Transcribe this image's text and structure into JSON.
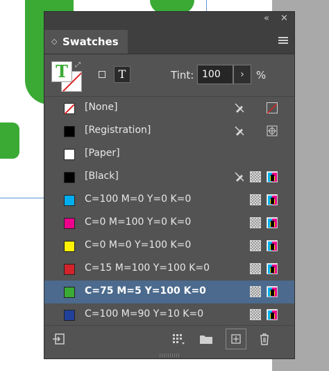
{
  "panel": {
    "title": "Swatches",
    "collapse_label": "«",
    "close_label": "✕",
    "tint_label": "Tint:",
    "tint_value": "100",
    "tint_unit": "%",
    "stepper_label": "›",
    "text_target_label": "T",
    "fill_letter": "T"
  },
  "swatches": [
    {
      "label": "[None]",
      "color": "none",
      "locked": true,
      "right_icon": "none-icon"
    },
    {
      "label": "[Registration]",
      "color": "#000000",
      "locked": true,
      "right_icon": "registration-icon"
    },
    {
      "label": "[Paper]",
      "color": "#ffffff",
      "locked": false,
      "right_icon": ""
    },
    {
      "label": "[Black]",
      "color": "#000000",
      "locked": true,
      "right_icon": "cmyk"
    },
    {
      "label": "C=100 M=0 Y=0 K=0",
      "color": "#00aeef",
      "locked": false,
      "right_icon": "cmyk"
    },
    {
      "label": "C=0 M=100 Y=0 K=0",
      "color": "#ec008c",
      "locked": false,
      "right_icon": "cmyk"
    },
    {
      "label": "C=0 M=0 Y=100 K=0",
      "color": "#fff200",
      "locked": false,
      "right_icon": "cmyk"
    },
    {
      "label": "C=15 M=100 Y=100 K=0",
      "color": "#d2232a",
      "locked": false,
      "right_icon": "cmyk"
    },
    {
      "label": "C=75 M=5 Y=100 K=0",
      "color": "#3aaa35",
      "locked": false,
      "right_icon": "cmyk",
      "selected": true
    },
    {
      "label": "C=100 M=90 Y=10 K=0",
      "color": "#21409a",
      "locked": false,
      "right_icon": "cmyk"
    }
  ],
  "bottom_icons": [
    "import-swatch-icon",
    "swatch-view-icon",
    "new-color-group-icon",
    "new-swatch-icon",
    "delete-swatch-icon"
  ],
  "colors": {
    "accent_green": "#3aaa35",
    "selected_row": "#4b6a8d",
    "panel_bg": "#535353"
  }
}
